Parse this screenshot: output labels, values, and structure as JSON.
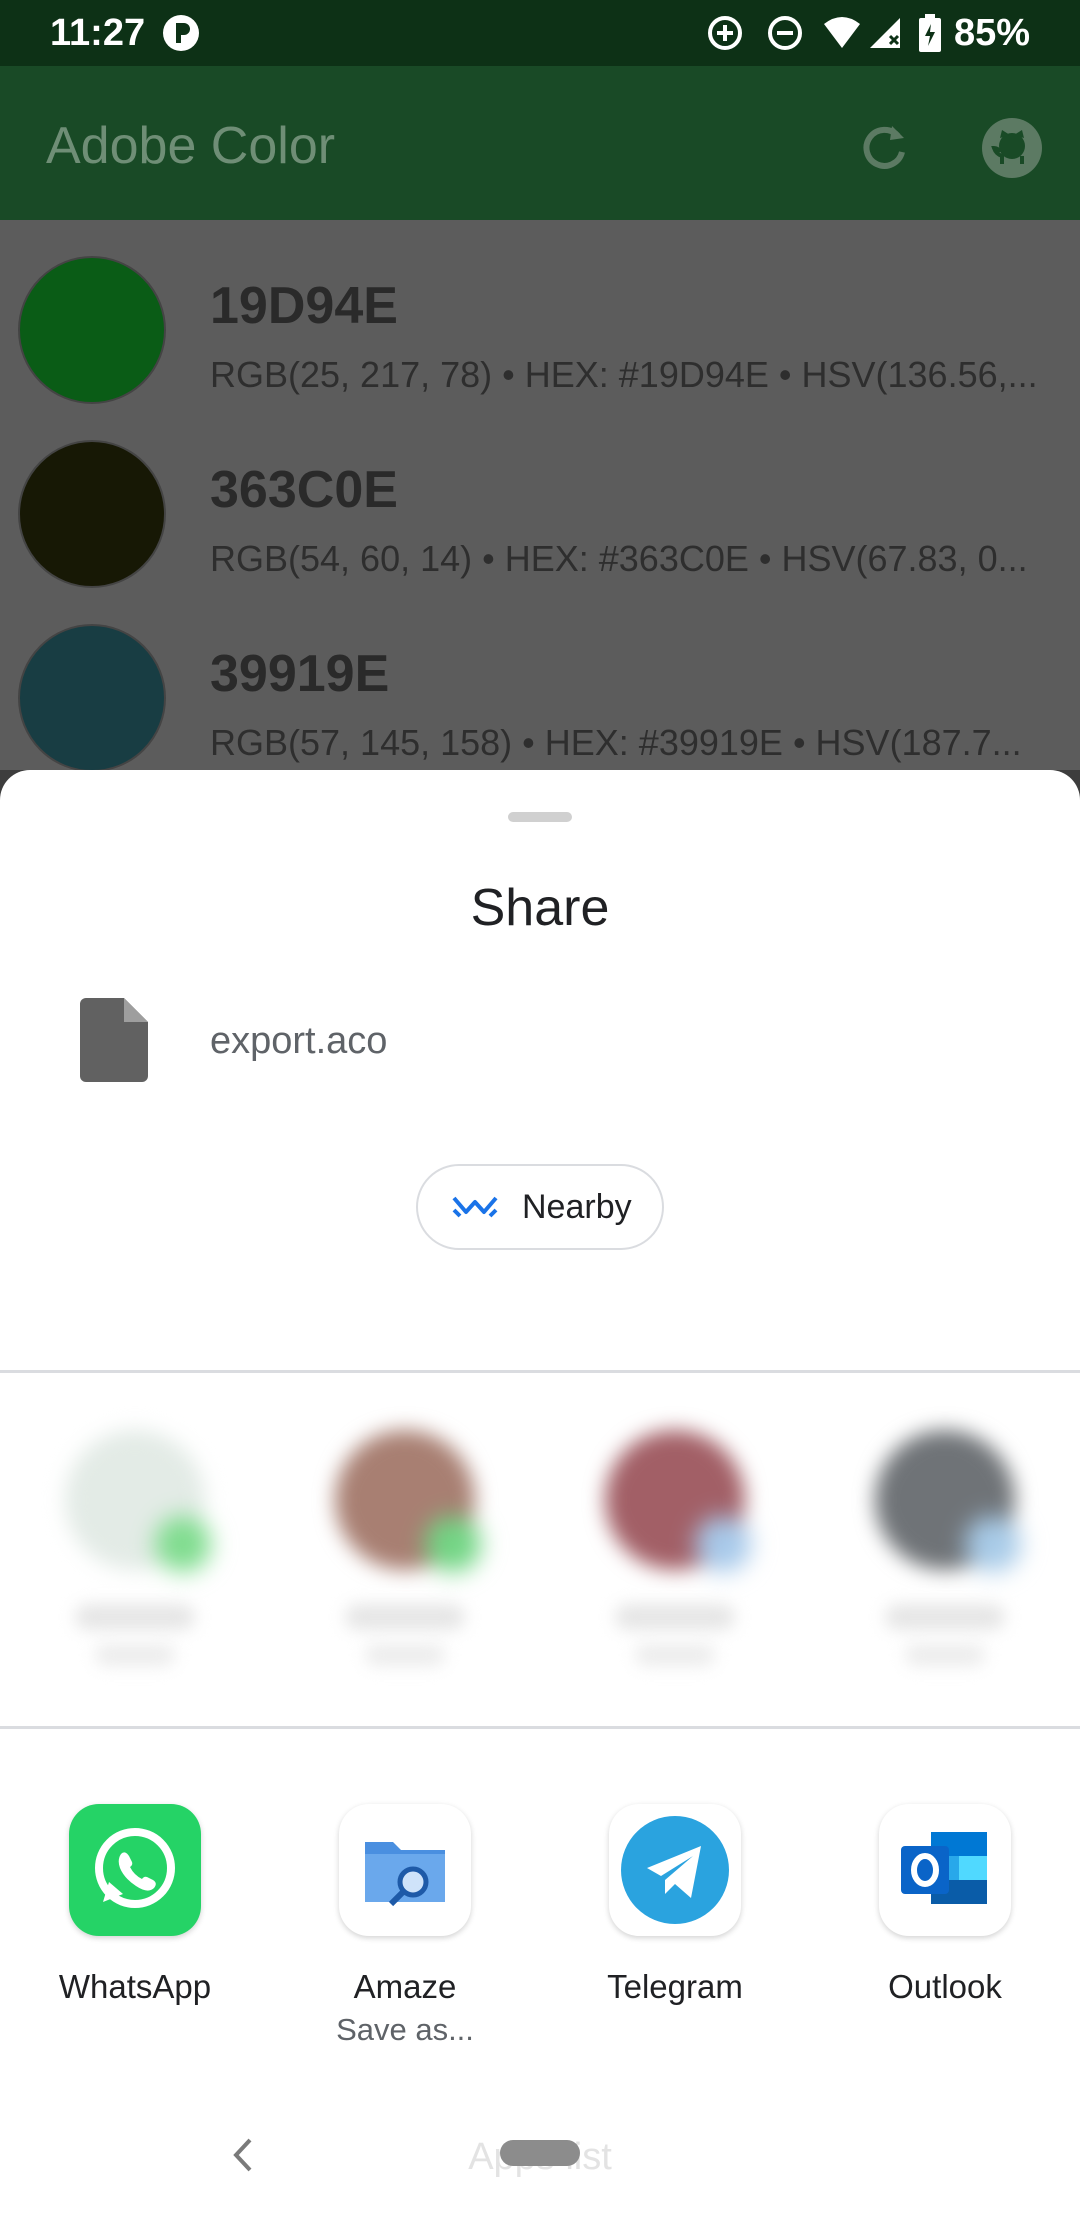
{
  "status_bar": {
    "time": "11:27",
    "battery": "85%",
    "icons": [
      "notification-p-icon",
      "data-saver-icon",
      "do-not-disturb-icon",
      "wifi-icon",
      "signal-icon",
      "battery-icon"
    ]
  },
  "app_bar": {
    "title": "Adobe Color",
    "actions": [
      "refresh-icon",
      "github-icon"
    ]
  },
  "colors": [
    {
      "name": "19D94E",
      "detail": "RGB(25, 217, 78) • HEX: #19D94E • HSV(136.56,...",
      "swatch": "#0a5c16"
    },
    {
      "name": "363C0E",
      "detail": "RGB(54, 60, 14) • HEX: #363C0E • HSV(67.83, 0...",
      "swatch": "#171805"
    },
    {
      "name": "39919E",
      "detail": "RGB(57, 145, 158) • HEX: #39919E • HSV(187.7...",
      "swatch": "#183d43"
    }
  ],
  "sheet": {
    "title": "Share",
    "file_name": "export.aco",
    "nearby_label": "Nearby"
  },
  "apps": [
    {
      "name": "WhatsApp",
      "sub": ""
    },
    {
      "name": "Amaze",
      "sub": "Save as..."
    },
    {
      "name": "Telegram",
      "sub": ""
    },
    {
      "name": "Outlook",
      "sub": ""
    }
  ],
  "nav": {
    "apps_list_label": "Apps list"
  },
  "colors_theme": {
    "whatsapp": "#25d366",
    "telegram": "#2aa3df",
    "outlook": "#0a64c8",
    "nearby": "#1a73e8"
  }
}
